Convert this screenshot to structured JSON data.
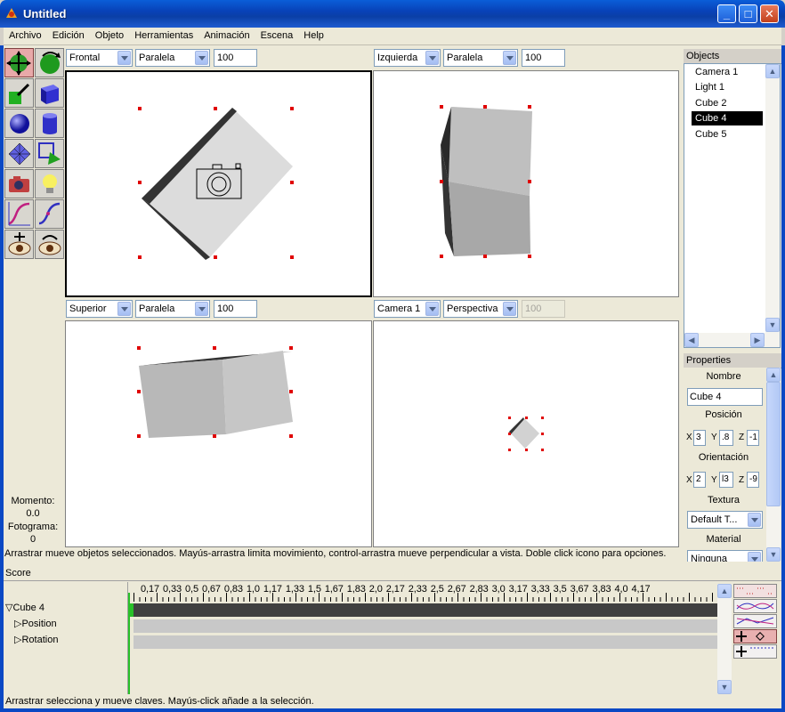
{
  "window": {
    "title": "Untitled"
  },
  "menu": [
    "Archivo",
    "Edición",
    "Objeto",
    "Herramientas",
    "Animación",
    "Escena",
    "Help"
  ],
  "viewports": [
    {
      "view": "Frontal",
      "projection": "Paralela",
      "zoom": "100"
    },
    {
      "view": "Izquierda",
      "projection": "Paralela",
      "zoom": "100"
    },
    {
      "view": "Superior",
      "projection": "Paralela",
      "zoom": "100"
    },
    {
      "view": "Camera 1",
      "projection": "Perspectiva",
      "zoom": "100"
    }
  ],
  "left_info": {
    "moment_label": "Momento:",
    "moment_value": "0.0",
    "frame_label": "Fotograma:",
    "frame_value": "0"
  },
  "objects": {
    "title": "Objects",
    "items": [
      "Camera 1",
      "Light 1",
      "Cube 2",
      "Cube 4",
      "Cube 5"
    ],
    "selected": "Cube 4"
  },
  "properties": {
    "title": "Properties",
    "name_label": "Nombre",
    "name_value": "Cube 4",
    "position_label": "Posición",
    "position": {
      "x": "3",
      "y": ".8",
      "z": "-1"
    },
    "orientation_label": "Orientación",
    "orientation": {
      "x": "2",
      "y": "l3",
      "z": "-9"
    },
    "texture_label": "Textura",
    "texture_value": "Default T...",
    "material_label": "Material",
    "material_value": "Ninguna"
  },
  "status_viewport": "Arrastrar mueve objetos seleccionados. Mayús-arrastra limita movimiento, control-arrastra mueve perpendicular a vista. Doble click icono para opciones.",
  "score": {
    "title": "Score",
    "ruler": [
      "0,17",
      "0,33",
      "0,5",
      "0,67",
      "0,83",
      "1,0",
      "1,17",
      "1,33",
      "1,5",
      "1,67",
      "1,83",
      "2,0",
      "2,17",
      "2,33",
      "2,5",
      "2,67",
      "2,83",
      "3,0",
      "3,17",
      "3,33",
      "3,5",
      "3,67",
      "3,83",
      "4,0",
      "4,17"
    ],
    "tracks": [
      {
        "label": "Cube 4",
        "expanded": true
      },
      {
        "label": "Position",
        "expanded": false
      },
      {
        "label": "Rotation",
        "expanded": false
      }
    ],
    "status": "Arrastrar selecciona y mueve claves. Mayús-click añade a la selección."
  },
  "colors": {
    "titlebar": "#0a48c4",
    "selection": "#000000",
    "handle": "#e00000",
    "timeline_dark": "#404040",
    "timeline_light": "#c8c8c8",
    "cursor": "#28c028"
  }
}
